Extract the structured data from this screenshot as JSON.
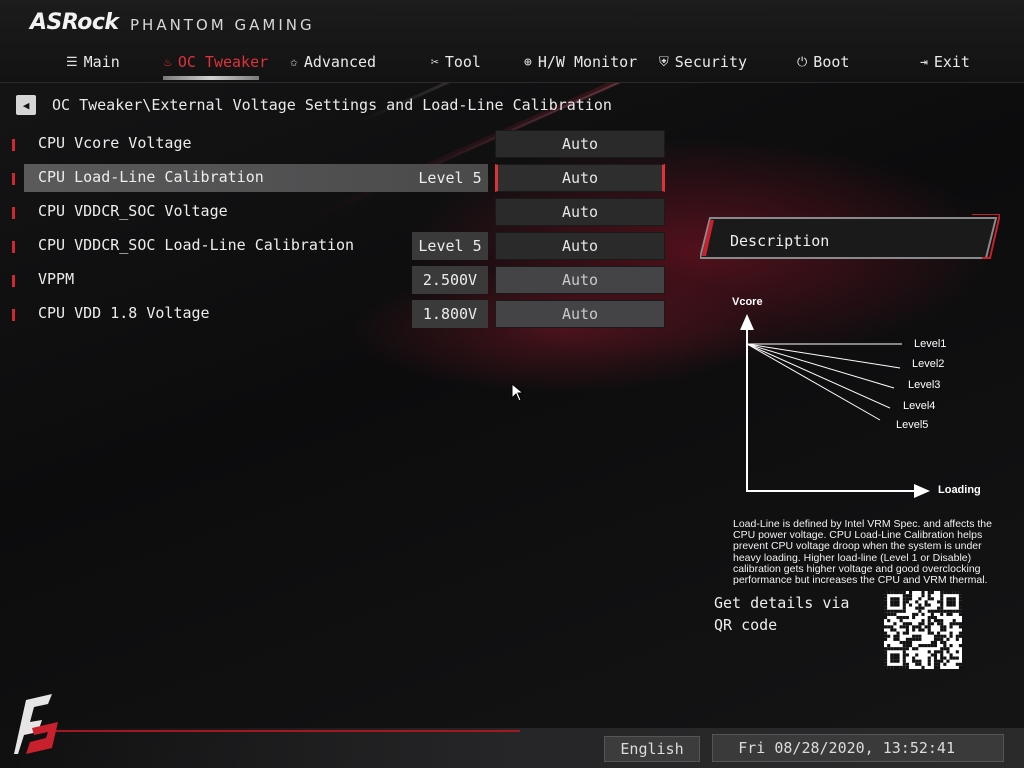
{
  "brand": {
    "logo": "ASRock",
    "subtitle": "PHANTOM GAMING"
  },
  "tabs": [
    {
      "label": "Main",
      "icon": "list-icon"
    },
    {
      "label": "OC Tweaker",
      "icon": "fire-icon"
    },
    {
      "label": "Advanced",
      "icon": "star-icon"
    },
    {
      "label": "Tool",
      "icon": "tools-icon"
    },
    {
      "label": "H/W Monitor",
      "icon": "monitor-icon"
    },
    {
      "label": "Security",
      "icon": "shield-icon"
    },
    {
      "label": "Boot",
      "icon": "power-icon"
    },
    {
      "label": "Exit",
      "icon": "exit-icon"
    }
  ],
  "active_tab": "OC Tweaker",
  "breadcrumb": "OC Tweaker\\External Voltage Settings and Load-Line Calibration",
  "settings": [
    {
      "name": "CPU Vcore Voltage",
      "current": "",
      "value": "Auto"
    },
    {
      "name": "CPU Load-Line Calibration",
      "current": "Level 5",
      "value": "Auto"
    },
    {
      "name": "CPU VDDCR_SOC Voltage",
      "current": "",
      "value": "Auto"
    },
    {
      "name": "CPU VDDCR_SOC Load-Line Calibration",
      "current": "Level 5",
      "value": "Auto"
    },
    {
      "name": "VPPM",
      "current": "2.500V",
      "value": "Auto"
    },
    {
      "name": "CPU VDD 1.8 Voltage",
      "current": "1.800V",
      "value": "Auto"
    }
  ],
  "description": {
    "title": "Description",
    "diagram": {
      "y_label": "Vcore",
      "x_label": "Loading",
      "levels": [
        "Level1",
        "Level2",
        "Level3",
        "Level4",
        "Level5"
      ]
    },
    "text": "Load-Line is defined by Intel VRM Spec. and affects the CPU power voltage. CPU Load-Line Calibration helps prevent CPU voltage droop when the system is under heavy loading. Higher load-line (Level 1 or Disable) calibration gets higher voltage and good overclocking performance but increases the CPU and VRM thermal.",
    "qr_label": "Get details via QR code"
  },
  "footer": {
    "language": "English",
    "datetime": "Fri 08/28/2020, 13:52:41"
  },
  "colors": {
    "accent": "#e0303a",
    "background": "#0b0b0c"
  }
}
